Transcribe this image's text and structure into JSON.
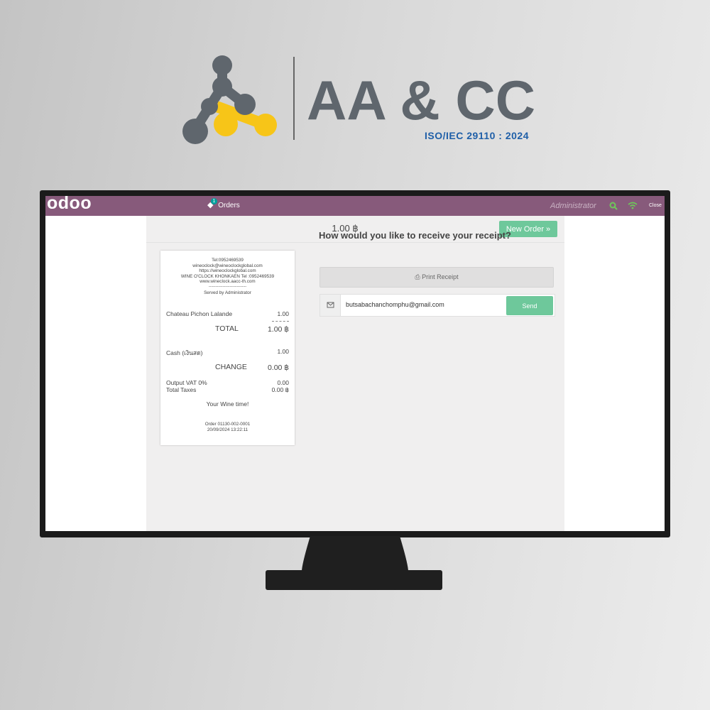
{
  "brand": {
    "logo_text": "AA & CC",
    "subtitle": "ISO/IEC 29110 : 2024",
    "accent_gray": "#5f666d",
    "accent_yellow": "#f7c518",
    "subtitle_color": "#1f5fa8"
  },
  "navbar": {
    "logo": "odoo",
    "orders_label": "Orders",
    "orders_badge": "1",
    "user": "Administrator",
    "close_label": "Close",
    "color": "#875a7b"
  },
  "pos": {
    "total": "1.00 ฿",
    "new_order_label": "New Order »",
    "question": "How would you like to receive your receipt?",
    "print_label": "Print Receipt",
    "email_value": "butsabachanchomphu@gmail.com",
    "send_label": "Send"
  },
  "receipt": {
    "header_lines": [
      "Tel:0952469539",
      "wineoclock@wineoclockglobal.com",
      "https://wineoclockglobal.com",
      "WINE O'CLOCK KHONKAEN Tel :0952469539",
      "www.wineclock.aacc-th.com",
      "--------------------------------",
      "Served by Administrator"
    ],
    "line_item": {
      "name": "Chateau Pichon Lalande",
      "qty": "1.00"
    },
    "total_label": "TOTAL",
    "total_value": "1.00 ฿",
    "payment": {
      "name": "Cash (เงินสด)",
      "amount": "1.00"
    },
    "change_label": "CHANGE",
    "change_value": "0.00 ฿",
    "tax_lines": [
      {
        "label": "Output VAT 0%",
        "value": "0.00"
      },
      {
        "label": "Total Taxes",
        "value": "0.00 ฿"
      }
    ],
    "footer_message": "Your Wine time!",
    "order_ref": "Order 01130-002-0001",
    "date": "20/09/2024 13:22:11"
  }
}
